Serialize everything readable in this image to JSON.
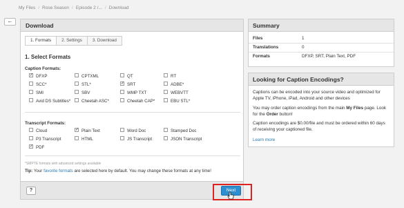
{
  "breadcrumb": [
    "My Files",
    "Rose Season",
    "Episode 2 /...",
    "Download"
  ],
  "back_icon": "←",
  "main": {
    "title": "Download",
    "steps": [
      "1. Formats",
      "2. Settings",
      "3. Download"
    ],
    "section_title": "1. Select Formats",
    "caption_label": "Caption Formats:",
    "transcript_label": "Transcript Formats:",
    "caption_formats": [
      {
        "label": "DFXP",
        "checked": true
      },
      {
        "label": "CPTXML",
        "checked": false
      },
      {
        "label": "QT",
        "checked": false
      },
      {
        "label": "RT",
        "checked": false
      },
      {
        "label": "SCC*",
        "checked": false
      },
      {
        "label": "STL*",
        "checked": false
      },
      {
        "label": "SRT",
        "checked": true
      },
      {
        "label": "ADBE*",
        "checked": false
      },
      {
        "label": "SMI",
        "checked": false
      },
      {
        "label": "SBV",
        "checked": false
      },
      {
        "label": "WMP TXT",
        "checked": false
      },
      {
        "label": "WEBVTT",
        "checked": false
      },
      {
        "label": "Avid DS Subtitles*",
        "checked": false
      },
      {
        "label": "Cheetah ASC*",
        "checked": false
      },
      {
        "label": "Cheetah CAP*",
        "checked": false
      },
      {
        "label": "EBU STL*",
        "checked": false
      }
    ],
    "transcript_formats": [
      {
        "label": "Cloud",
        "checked": false
      },
      {
        "label": "Plain Text",
        "checked": true
      },
      {
        "label": "Word Doc",
        "checked": false
      },
      {
        "label": "Stamped Doc",
        "checked": false
      },
      {
        "label": "P3 Transcript",
        "checked": false
      },
      {
        "label": "HTML",
        "checked": false
      },
      {
        "label": "JS Transcript",
        "checked": false
      },
      {
        "label": "JSON Transcript",
        "checked": false
      },
      {
        "label": "PDF",
        "checked": true
      }
    ],
    "fine_print": "*SMPTE formats with advanced settings available",
    "tip_label": "Tip:",
    "tip_pre": "Your",
    "tip_link": "favorite formats",
    "tip_post": "are selected here by default. You may change these formats at any time!",
    "help_label": "?",
    "next_label": "Next"
  },
  "summary": {
    "title": "Summary",
    "rows": [
      {
        "key": "Files",
        "value": "1"
      },
      {
        "key": "Translations",
        "value": "0"
      },
      {
        "key": "Formats",
        "value": "DFXP, SRT, Plain Text, PDF"
      }
    ]
  },
  "encodings": {
    "title": "Looking for Caption Encodings?",
    "p1": "Captions can be encoded into your source video and optimized for Apple TV, iPhone, iPad, Android and other devices",
    "p2_pre": "You may order caption encodings from the main",
    "p2_bold1": "My Files",
    "p2_mid": "page. Look for the",
    "p2_bold2": "Order",
    "p2_post": "button!",
    "p3": "Caption encodings are $0.00/file and must be ordered within 60 days of receiving your captioned file.",
    "learn_more": "Learn more"
  },
  "colors": {
    "accent": "#2d8fd0",
    "highlight": "#dd2222",
    "link": "#2a7ab0"
  }
}
